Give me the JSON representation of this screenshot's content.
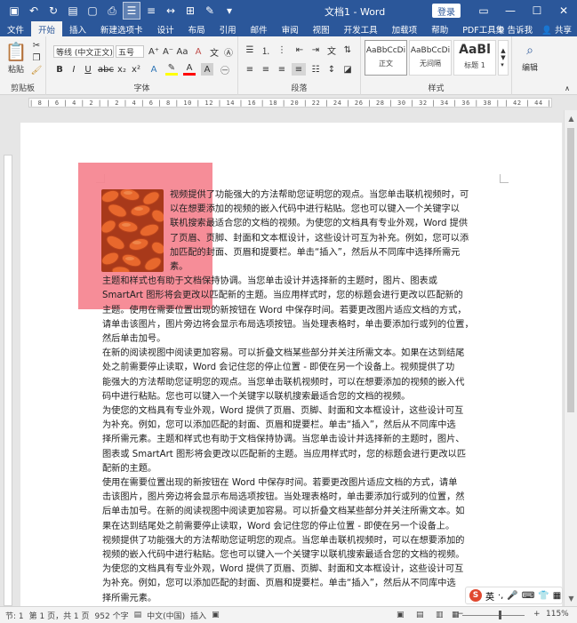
{
  "title_bar": {
    "doc_title": "文档1 - Word",
    "login": "登录"
  },
  "tabs": [
    "文件",
    "开始",
    "插入",
    "新建选项卡",
    "设计",
    "布局",
    "引用",
    "邮件",
    "审阅",
    "视图",
    "开发工具",
    "加载项",
    "帮助",
    "PDF工具集"
  ],
  "tabs_right": {
    "tell_me": "告诉我",
    "share": "共享"
  },
  "ribbon": {
    "clipboard": {
      "paste": "粘贴",
      "label": "剪贴板"
    },
    "font": {
      "font_name": "等线 (中文正文)",
      "font_size": "五号",
      "label": "字体"
    },
    "paragraph": {
      "label": "段落"
    },
    "styles": {
      "label": "样式",
      "items": [
        {
          "sample": "AaBbCcDi",
          "name": "正文"
        },
        {
          "sample": "AaBbCcDi",
          "name": "无间隔"
        },
        {
          "sample": "AaBl",
          "name": "标题 1"
        }
      ]
    },
    "editing": {
      "label": "编辑"
    }
  },
  "ruler": {
    "marks": "| 8 | 6 | 4 | 2 |   | 2 | 4 | 6 | 8 | 10 | 12 | 14 | 16 | 18 | 20 | 22 | 24 | 26 | 28 | 30 | 32 | 34 | 36 | 38 |  | 42 | 44 | 46 | 48 |"
  },
  "document": {
    "lines": [
      "视频提供了功能强大的方法帮助您证明您的观点。当您单击联机视频时，可",
      "以在想要添加的视频的嵌入代码中进行粘贴。您也可以键入一个关键字以",
      "联机搜索最适合您的文档的视频。为使您的文档具有专业外观，Word 提供",
      "了页眉、页脚、封面和文本框设计，这些设计可互为补充。例如，您可以添",
      "加匹配的封面、页眉和提要栏。单击“插入”，然后从不同库中选择所需元",
      "素。",
      "主题和样式也有助于文档保持协调。当您单击设计并选择新的主题时，图片、图表或",
      "SmartArt 图形将会更改以匹配新的主题。当应用样式时，您的标题会进行更改以匹配新的",
      "主题。使用在需要位置出现的新按钮在 Word 中保存时间。若要更改图片适应文档的方式，",
      "请单击该图片，图片旁边将会显示布局选项按钮。当处理表格时，单击要添加行或列的位置，",
      "然后单击加号。",
      "在新的阅读视图中阅读更加容易。可以折叠文档某些部分并关注所需文本。如果在达到结尾",
      "处之前需要停止读取，Word 会记住您的停止位置 - 即使在另一个设备上。视频提供了功",
      "能强大的方法帮助您证明您的观点。当您单击联机视频时，可以在想要添加的视频的嵌入代",
      "码中进行粘贴。您也可以键入一个关键字以联机搜索最适合您的文档的视频。",
      "为使您的文档具有专业外观，Word 提供了页眉、页脚、封面和文本框设计，这些设计可互",
      "为补充。例如，您可以添加匹配的封面、页眉和提要栏。单击“插入”，然后从不同库中选",
      "择所需元素。主题和样式也有助于文档保持协调。当您单击设计并选择新的主题时，图片、",
      "图表或 SmartArt 图形将会更改以匹配新的主题。当应用样式时，您的标题会进行更改以匹",
      "配新的主题。",
      "使用在需要位置出现的新按钮在 Word 中保存时间。若要更改图片适应文档的方式，请单",
      "击该图片，图片旁边将会显示布局选项按钮。当处理表格时，单击要添加行或列的位置，然",
      "后单击加号。在新的阅读视图中阅读更加容易。可以折叠文档某些部分并关注所需文本。如",
      "果在达到结尾处之前需要停止读取，Word 会记住您的停止位置 - 即使在另一个设备上。",
      "视频提供了功能强大的方法帮助您证明您的观点。当您单击联机视频时，可以在想要添加的",
      "视频的嵌入代码中进行粘贴。您也可以键入一个关键字以联机搜索最适合您的文档的视频。",
      "为使您的文档具有专业外观，Word 提供了页眉、页脚、封面和文本框设计，这些设计可互",
      "为补充。例如，您可以添加匹配的封面、页眉和提要栏。单击“插入”，然后从不同库中选",
      "择所需元素。"
    ]
  },
  "ime": {
    "lang": "英"
  },
  "status_bar": {
    "section": "节: 1",
    "page": "第 1 页，共 1 页",
    "words": "952 个字",
    "language": "中文(中国)",
    "mode": "插入",
    "zoom": "115%"
  },
  "colors": {
    "title_bar": "#2b579a",
    "highlight": "#f5838f"
  }
}
